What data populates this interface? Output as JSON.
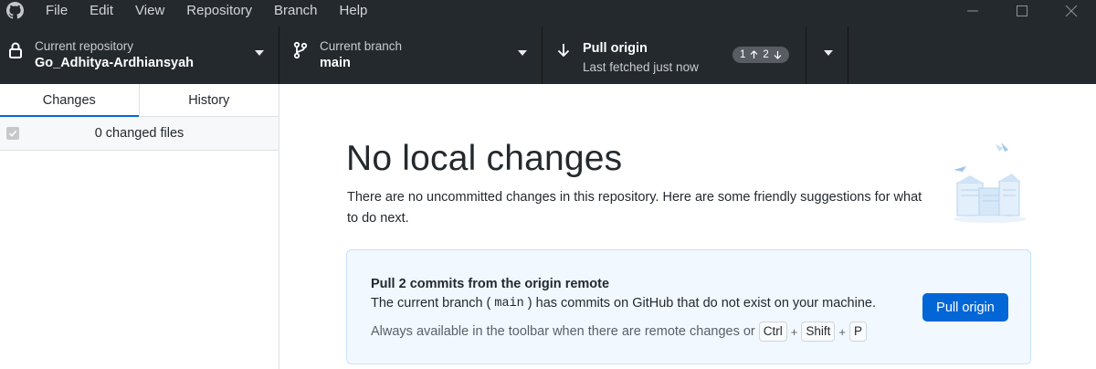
{
  "menu": {
    "items": [
      "File",
      "Edit",
      "View",
      "Repository",
      "Branch",
      "Help"
    ]
  },
  "toolbar": {
    "repo_label": "Current repository",
    "repo_value": "Go_Adhitya-Ardhiansyah",
    "branch_label": "Current branch",
    "branch_value": "main",
    "pull_title": "Pull origin",
    "pull_subtitle": "Last fetched just now",
    "ahead": "1",
    "behind": "2"
  },
  "sidebar": {
    "tabs": [
      {
        "label": "Changes",
        "active": true
      },
      {
        "label": "History",
        "active": false
      }
    ],
    "changed_files": "0 changed files"
  },
  "main": {
    "title": "No local changes",
    "description": "There are no uncommitted changes in this repository. Here are some friendly suggestions for what to do next.",
    "callout": {
      "title": "Pull 2 commits from the origin remote",
      "body_before": "The current branch (",
      "body_code": "main",
      "body_after": ") has commits on GitHub that do not exist on your machine.",
      "hint": "Always available in the toolbar when there are remote changes or",
      "keys": [
        "Ctrl",
        "Shift",
        "P"
      ],
      "button": "Pull origin"
    }
  },
  "colors": {
    "toolbar_bg": "#24292e",
    "accent": "#0366d6",
    "callout_bg": "#f1f8ff",
    "callout_border": "#c8e1ff"
  },
  "icons": {
    "app": "github-octocat-icon",
    "repo": "lock-icon",
    "branch": "git-branch-icon",
    "pull": "arrow-down-icon"
  }
}
